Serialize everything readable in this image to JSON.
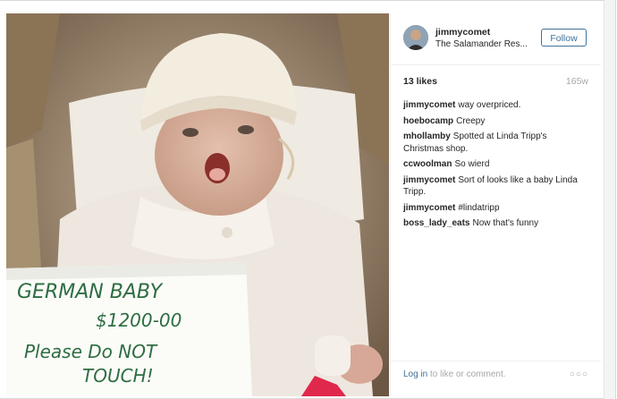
{
  "post": {
    "username": "jimmycomet",
    "location": "The Salamander Res...",
    "follow_label": "Follow",
    "likes": "13 likes",
    "age": "165w"
  },
  "sign": {
    "line1": "GERMAN BABY",
    "line2": "$1200-00",
    "line3": "Please Do NOT",
    "line4": "TOUCH!"
  },
  "comments": [
    {
      "author": "jimmycomet",
      "text": "way overpriced."
    },
    {
      "author": "hoebocamp",
      "text": "Creepy"
    },
    {
      "author": "mhollamby",
      "text": "Spotted at Linda Tripp's Christmas shop."
    },
    {
      "author": "ccwoolman",
      "text": "So wierd"
    },
    {
      "author": "jimmycomet",
      "text": "Sort of looks like a baby Linda Tripp."
    },
    {
      "author": "jimmycomet",
      "text": "#lindatripp"
    },
    {
      "author": "boss_lady_eats",
      "text": "Now that's funny"
    }
  ],
  "footer": {
    "login_link": "Log in",
    "login_rest": "to like or comment.",
    "more": "○○○"
  },
  "colors": {
    "link": "#3f729b",
    "muted": "#a5a7aa",
    "text": "#262626"
  }
}
